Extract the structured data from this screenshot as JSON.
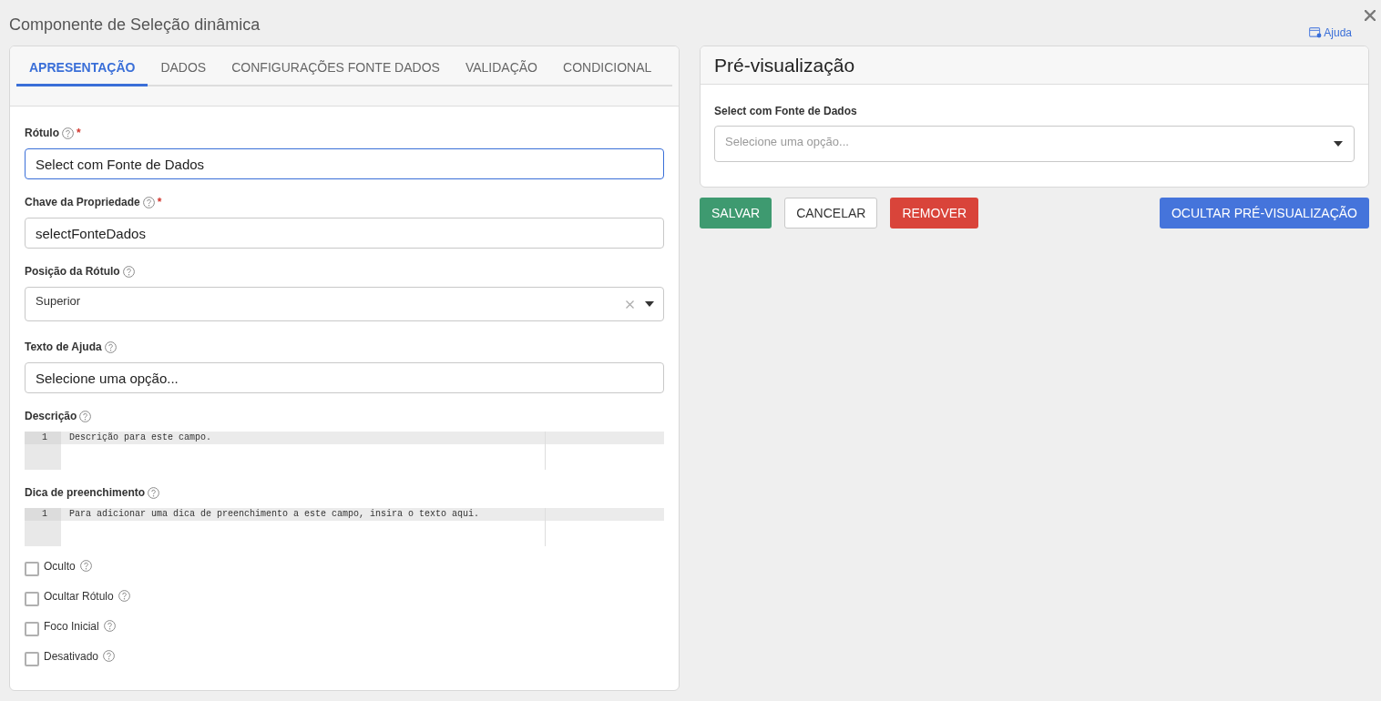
{
  "window": {
    "title": "Componente de Seleção dinâmica",
    "help_link": "Ajuda"
  },
  "tabs": [
    {
      "label": "APRESENTAÇÃO",
      "selected": true
    },
    {
      "label": "DADOS",
      "selected": false
    },
    {
      "label": "CONFIGURAÇÕES FONTE DADOS",
      "selected": false
    },
    {
      "label": "VALIDAÇÃO",
      "selected": false
    },
    {
      "label": "CONDICIONAL",
      "selected": false
    }
  ],
  "fields": [
    {
      "kind": "text",
      "label": "Rótulo",
      "help": true,
      "required_mark": "*",
      "value": "Select com Fonte de Dados",
      "focused": true
    },
    {
      "kind": "text",
      "label": "Chave da Propriedade",
      "help": true,
      "required_mark": "*",
      "value": "selectFonteDados",
      "focused": false
    },
    {
      "kind": "select",
      "label": "Posição da Rótulo",
      "help": true,
      "value": "Superior",
      "clearable": true
    },
    {
      "kind": "text",
      "label": "Texto de Ajuda",
      "help": true,
      "value": "Selecione uma opção...",
      "focused": false
    },
    {
      "kind": "code",
      "label": "Descrição",
      "help": true,
      "lines": [
        {
          "number": "1",
          "text": "Descrição para este campo.",
          "active": true
        }
      ]
    },
    {
      "kind": "code",
      "label": "Dica de preenchimento",
      "help": true,
      "lines": [
        {
          "number": "1",
          "text": "Para adicionar uma dica de preenchimento a este campo, insira o texto aqui.",
          "active": true
        }
      ]
    }
  ],
  "checkboxes": [
    {
      "label": "Oculto",
      "help": true,
      "checked": false
    },
    {
      "label": "Ocultar Rótulo",
      "help": true,
      "checked": false
    },
    {
      "label": "Foco Inicial",
      "help": true,
      "checked": false
    },
    {
      "label": "Desativado",
      "help": true,
      "checked": false
    }
  ],
  "preview": {
    "title": "Pré-visualização",
    "field": {
      "label": "Select com Fonte de Dados",
      "placeholder": "Selecione uma opção..."
    }
  },
  "actions": [
    {
      "label": "SALVAR",
      "kind": "success"
    },
    {
      "label": "CANCELAR",
      "kind": "default"
    },
    {
      "label": "REMOVER",
      "kind": "danger"
    }
  ],
  "toggle_button": {
    "label": "OCULTAR PRÉ-VISUALIZAÇÃO",
    "kind": "primary"
  }
}
